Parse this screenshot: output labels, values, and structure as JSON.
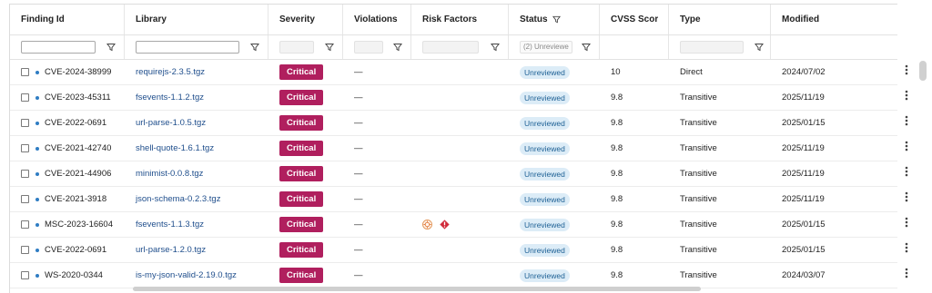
{
  "columns": [
    {
      "key": "finding_id",
      "label": "Finding Id"
    },
    {
      "key": "library",
      "label": "Library"
    },
    {
      "key": "severity",
      "label": "Severity"
    },
    {
      "key": "violations",
      "label": "Violations"
    },
    {
      "key": "risk_factors",
      "label": "Risk Factors"
    },
    {
      "key": "status",
      "label": "Status"
    },
    {
      "key": "cvss",
      "label": "CVSS Scor"
    },
    {
      "key": "type",
      "label": "Type"
    },
    {
      "key": "modified",
      "label": "Modified"
    }
  ],
  "filters": {
    "finding_id_value": "",
    "library_value": "",
    "status_value": "(2) Unreviewe"
  },
  "rows": [
    {
      "id": "CVE-2024-38999",
      "library": "requirejs-2.3.5.tgz",
      "severity": "Critical",
      "violations": "—",
      "status": "Unreviewed",
      "cvss": "10",
      "type": "Direct",
      "modified": "2024/07/02",
      "risk": []
    },
    {
      "id": "CVE-2023-45311",
      "library": "fsevents-1.1.2.tgz",
      "severity": "Critical",
      "violations": "—",
      "status": "Unreviewed",
      "cvss": "9.8",
      "type": "Transitive",
      "modified": "2025/11/19",
      "risk": []
    },
    {
      "id": "CVE-2022-0691",
      "library": "url-parse-1.0.5.tgz",
      "severity": "Critical",
      "violations": "—",
      "status": "Unreviewed",
      "cvss": "9.8",
      "type": "Transitive",
      "modified": "2025/01/15",
      "risk": []
    },
    {
      "id": "CVE-2021-42740",
      "library": "shell-quote-1.6.1.tgz",
      "severity": "Critical",
      "violations": "—",
      "status": "Unreviewed",
      "cvss": "9.8",
      "type": "Transitive",
      "modified": "2025/11/19",
      "risk": []
    },
    {
      "id": "CVE-2021-44906",
      "library": "minimist-0.0.8.tgz",
      "severity": "Critical",
      "violations": "—",
      "status": "Unreviewed",
      "cvss": "9.8",
      "type": "Transitive",
      "modified": "2025/11/19",
      "risk": []
    },
    {
      "id": "CVE-2021-3918",
      "library": "json-schema-0.2.3.tgz",
      "severity": "Critical",
      "violations": "—",
      "status": "Unreviewed",
      "cvss": "9.8",
      "type": "Transitive",
      "modified": "2025/11/19",
      "risk": []
    },
    {
      "id": "MSC-2023-16604",
      "library": "fsevents-1.1.3.tgz",
      "severity": "Critical",
      "violations": "—",
      "status": "Unreviewed",
      "cvss": "9.8",
      "type": "Transitive",
      "modified": "2025/01/15",
      "risk": [
        "target-icon",
        "malicious-alert-icon"
      ]
    },
    {
      "id": "CVE-2022-0691",
      "library": "url-parse-1.2.0.tgz",
      "severity": "Critical",
      "violations": "—",
      "status": "Unreviewed",
      "cvss": "9.8",
      "type": "Transitive",
      "modified": "2025/01/15",
      "risk": []
    },
    {
      "id": "WS-2020-0344",
      "library": "is-my-json-valid-2.19.0.tgz",
      "severity": "Critical",
      "violations": "—",
      "status": "Unreviewed",
      "cvss": "9.8",
      "type": "Transitive",
      "modified": "2024/03/07",
      "risk": []
    }
  ],
  "colors": {
    "critical": "#b01f5e",
    "link": "#1f4e8c",
    "status_bg": "#dcecf7",
    "status_text": "#1c5f94",
    "dot": "#2f7dc3"
  },
  "row_menu_icon": "kebab-menu-icon"
}
